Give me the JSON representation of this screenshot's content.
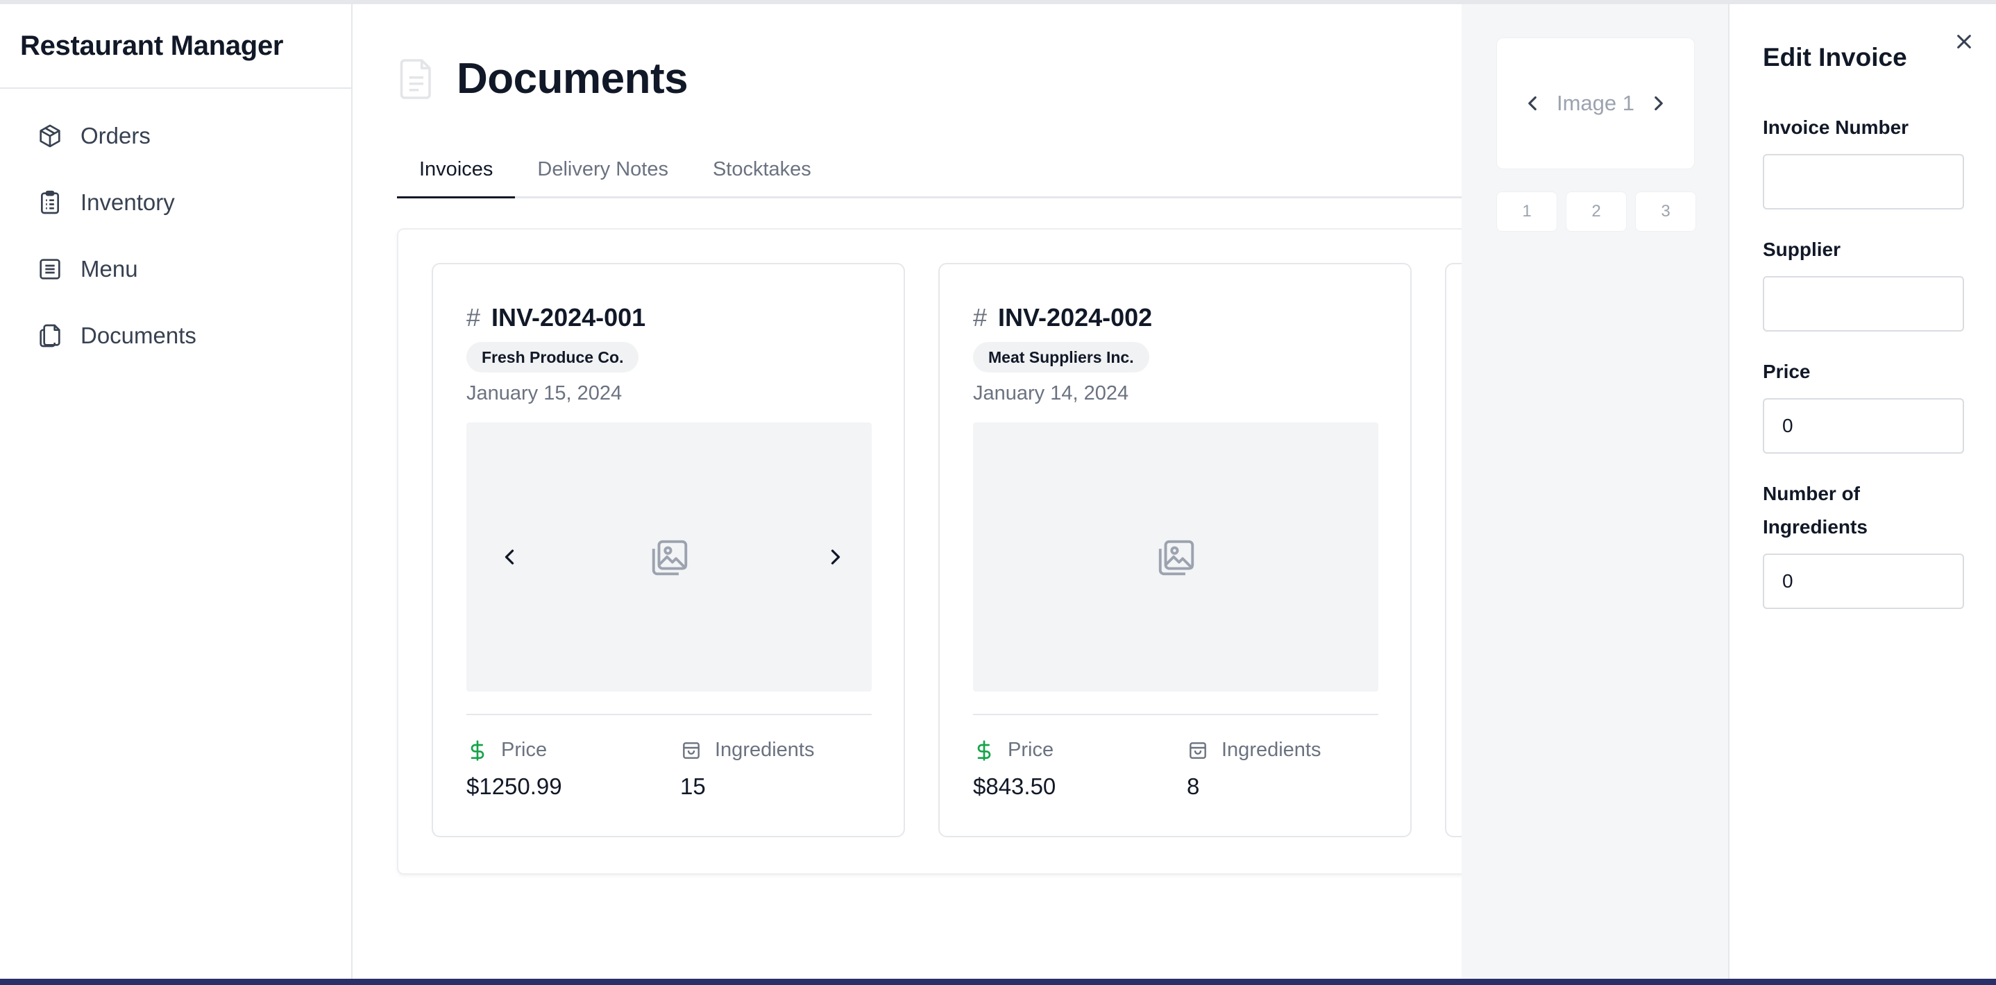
{
  "app": {
    "title": "Restaurant Manager"
  },
  "sidebar": {
    "items": [
      {
        "label": "Orders",
        "icon": "package-icon"
      },
      {
        "label": "Inventory",
        "icon": "clipboard-list-icon"
      },
      {
        "label": "Menu",
        "icon": "menu-list-icon"
      },
      {
        "label": "Documents",
        "icon": "documents-icon"
      }
    ]
  },
  "page": {
    "title": "Documents",
    "icon": "document-icon"
  },
  "tabs": [
    {
      "label": "Invoices",
      "active": true
    },
    {
      "label": "Delivery Notes",
      "active": false
    },
    {
      "label": "Stocktakes",
      "active": false
    }
  ],
  "invoices": [
    {
      "hash": "#",
      "number": "INV-2024-001",
      "supplier": "Fresh Produce Co.",
      "date": "January 15, 2024",
      "price_label": "Price",
      "price": "$1250.99",
      "ingredients_label": "Ingredients",
      "ingredients": "15"
    },
    {
      "hash": "#",
      "number": "INV-2024-002",
      "supplier": "Meat Suppliers Inc.",
      "date": "January 14, 2024",
      "price_label": "Price",
      "price": "$843.50",
      "ingredients_label": "Ingredients",
      "ingredients": "8"
    }
  ],
  "gallery": {
    "label": "Image 1",
    "pages": [
      "1",
      "2",
      "3"
    ]
  },
  "edit_invoice": {
    "title": "Edit Invoice",
    "fields": [
      {
        "label": "Invoice Number",
        "value": ""
      },
      {
        "label": "Supplier",
        "value": ""
      },
      {
        "label": "Price",
        "value": "0"
      },
      {
        "label": "Number of Ingredients",
        "value": "0"
      }
    ]
  },
  "colors": {
    "accent_green": "#16a34a",
    "text_primary": "#111827",
    "text_muted": "#6b7280",
    "border": "#e5e7eb"
  }
}
